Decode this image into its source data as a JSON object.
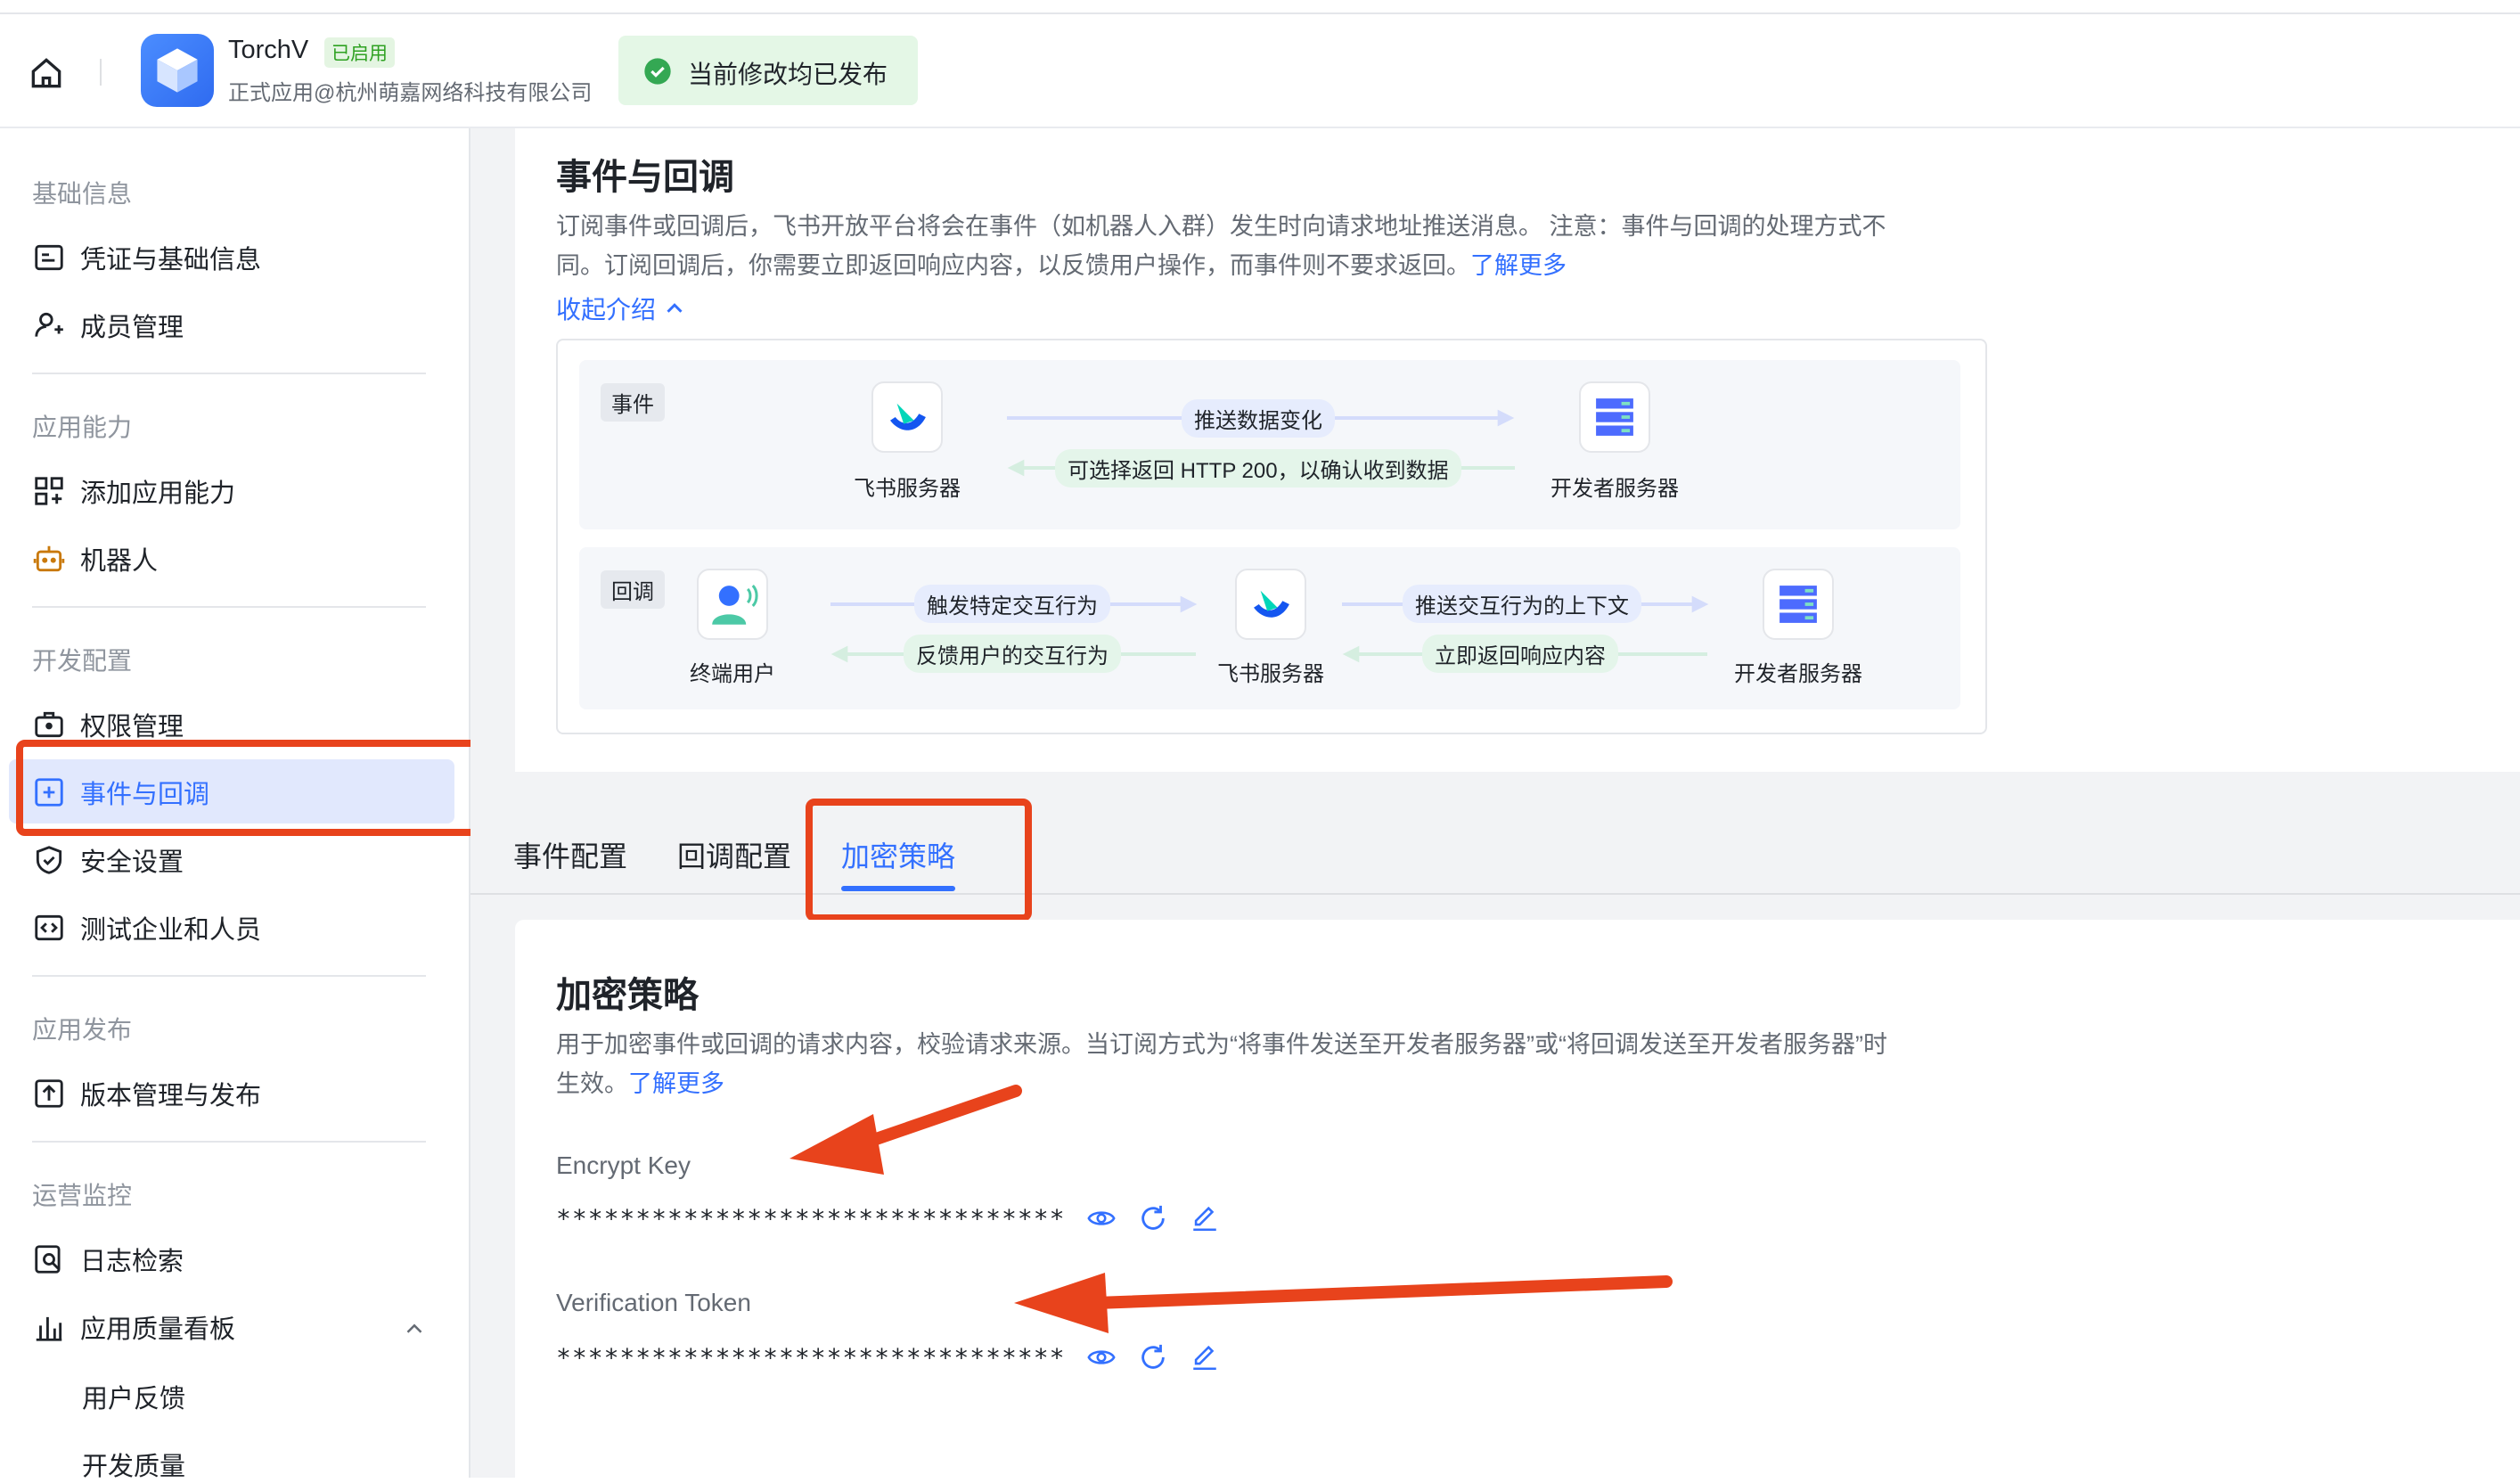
{
  "header": {
    "app_name": "TorchV",
    "app_status": "已启用",
    "app_org": "正式应用@杭州萌嘉网络科技有限公司",
    "publish_status": "当前修改均已发布"
  },
  "sidebar": {
    "sections": [
      {
        "title": "基础信息",
        "items": [
          "凭证与基础信息",
          "成员管理"
        ]
      },
      {
        "title": "应用能力",
        "items": [
          "添加应用能力",
          "机器人"
        ]
      },
      {
        "title": "开发配置",
        "items": [
          "权限管理",
          "事件与回调",
          "安全设置",
          "测试企业和人员"
        ]
      },
      {
        "title": "应用发布",
        "items": [
          "版本管理与发布"
        ]
      },
      {
        "title": "运营监控",
        "items": [
          "日志检索",
          "应用质量看板"
        ]
      }
    ],
    "sub_items": [
      "用户反馈",
      "开发质量"
    ],
    "active_item": "事件与回调"
  },
  "intro": {
    "title": "事件与回调",
    "desc_line1": "订阅事件或回调后，飞书开放平台将会在事件（如机器人入群）发生时向请求地址推送消息。 注意：事件与回调的处理方式不",
    "desc_line2": "同。订阅回调后，你需要立即返回响应内容，以反馈用户操作，而事件则不要求返回。",
    "learn_more": "了解更多",
    "collapse": "收起介绍"
  },
  "diagram": {
    "event": {
      "tag": "事件",
      "from": "飞书服务器",
      "to": "开发者服务器",
      "push": "推送数据变化",
      "ret": "可选择返回 HTTP 200，以确认收到数据"
    },
    "callback": {
      "tag": "回调",
      "user": "终端用户",
      "mid": "飞书服务器",
      "to": "开发者服务器",
      "trigger": "触发特定交互行为",
      "feedback": "反馈用户的交互行为",
      "push": "推送交互行为的上下文",
      "respond": "立即返回响应内容"
    }
  },
  "tabs": [
    "事件配置",
    "回调配置",
    "加密策略"
  ],
  "active_tab": "加密策略",
  "encrypt": {
    "title": "加密策略",
    "desc_line1": "用于加密事件或回调的请求内容，校验请求来源。当订阅方式为“将事件发送至开发者服务器”或“将回调发送至开发者服务器”时",
    "desc_line2": "生效。",
    "learn_more": "了解更多",
    "encrypt_key_label": "Encrypt Key",
    "encrypt_key_value": "********************************",
    "verification_token_label": "Verification Token",
    "verification_token_value": "********************************"
  },
  "colors": {
    "accent": "#3370ff",
    "annotation_red": "#e8431c",
    "success_green": "#2ea121"
  }
}
